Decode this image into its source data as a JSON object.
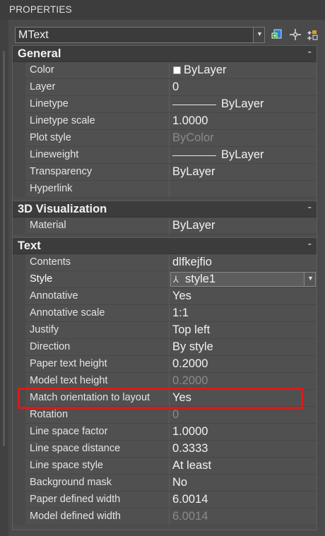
{
  "panel_title": "PROPERTIES",
  "selector": {
    "value": "MText"
  },
  "icons": {
    "selector_arrow": "chevron-down-icon",
    "quick_select": "quick-select-icon",
    "select_objects": "select-objects-icon",
    "toggle_pickadd": "toggle-pickadd-icon",
    "style_icon": "text-style-icon"
  },
  "sections": {
    "general": {
      "title": "General",
      "collapse": "-",
      "rows": {
        "color": {
          "name": "Color",
          "value": "ByLayer"
        },
        "layer": {
          "name": "Layer",
          "value": "0"
        },
        "linetype": {
          "name": "Linetype",
          "value": "ByLayer"
        },
        "linetype_scale": {
          "name": "Linetype scale",
          "value": "1.0000"
        },
        "plot_style": {
          "name": "Plot style",
          "value": "ByColor"
        },
        "lineweight": {
          "name": "Lineweight",
          "value": "ByLayer"
        },
        "transparency": {
          "name": "Transparency",
          "value": "ByLayer"
        },
        "hyperlink": {
          "name": "Hyperlink",
          "value": ""
        }
      }
    },
    "viz3d": {
      "title": "3D Visualization",
      "collapse": "-",
      "rows": {
        "material": {
          "name": "Material",
          "value": "ByLayer"
        }
      }
    },
    "text": {
      "title": "Text",
      "collapse": "-",
      "rows": {
        "contents": {
          "name": "Contents",
          "value": "dlfkejfio"
        },
        "style": {
          "name": "Style",
          "value": "style1"
        },
        "annotative": {
          "name": "Annotative",
          "value": "Yes"
        },
        "annotative_scale": {
          "name": "Annotative scale",
          "value": "1:1"
        },
        "justify": {
          "name": "Justify",
          "value": "Top left"
        },
        "direction": {
          "name": "Direction",
          "value": "By style"
        },
        "paper_text_height": {
          "name": "Paper text height",
          "value": "0.2000"
        },
        "model_text_height": {
          "name": "Model text height",
          "value": "0.2000"
        },
        "match_orientation": {
          "name": "Match orientation to layout",
          "value": "Yes"
        },
        "rotation": {
          "name": "Rotation",
          "value": "0"
        },
        "line_space_factor": {
          "name": "Line space factor",
          "value": "1.0000"
        },
        "line_space_distance": {
          "name": "Line space distance",
          "value": "0.3333"
        },
        "line_space_style": {
          "name": "Line space style",
          "value": "At least"
        },
        "background_mask": {
          "name": "Background mask",
          "value": "No"
        },
        "paper_defined_width": {
          "name": "Paper defined width",
          "value": "6.0014"
        },
        "model_defined_width": {
          "name": "Model defined width",
          "value": "6.0014"
        }
      }
    }
  },
  "colors": {
    "highlight_border": "#e01818",
    "disabled_text": "#8a8a8a"
  }
}
